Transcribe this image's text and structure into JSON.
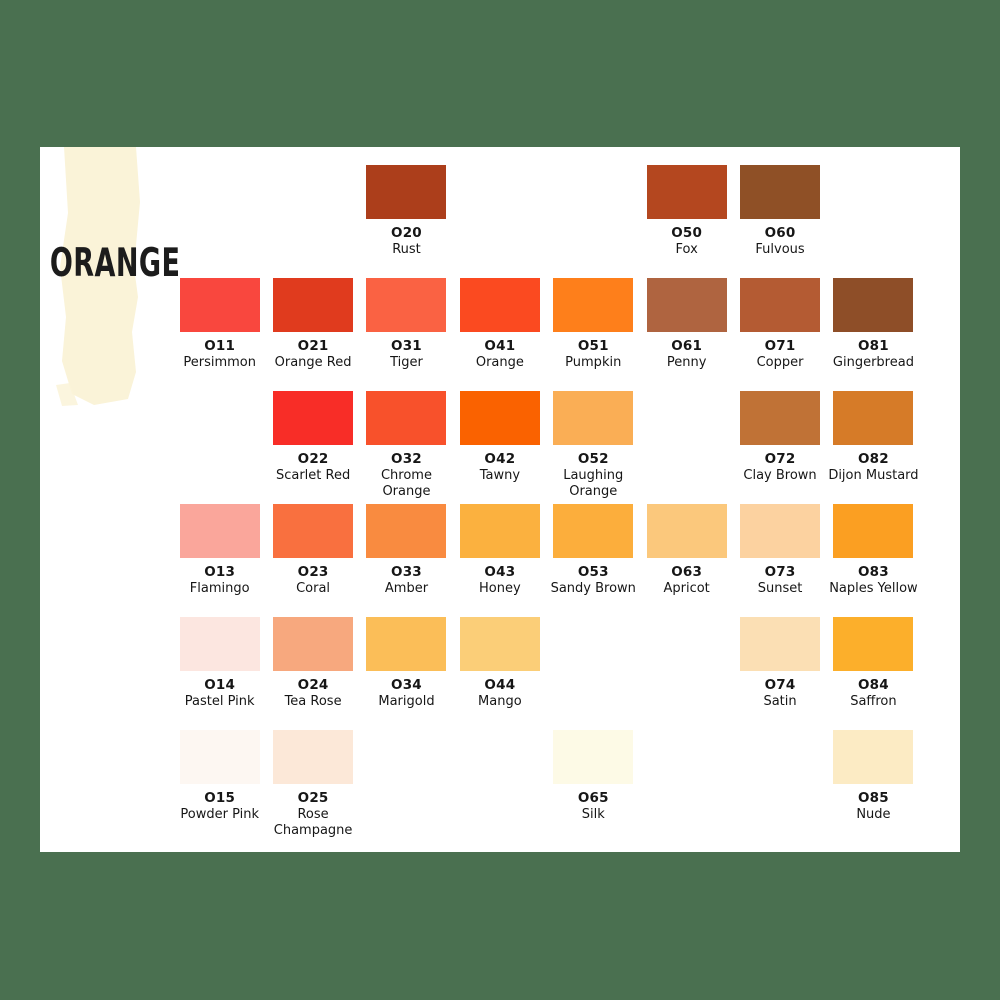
{
  "page": {
    "background_color": "#4a7050",
    "card_color": "#ffffff",
    "title": "ORANGE",
    "title_color": "#1c1c1c",
    "brush_color": "#faf3d8"
  },
  "chart_data": {
    "type": "table",
    "title": "ORANGE",
    "columns": 8,
    "rows": 6,
    "swatches": [
      [
        {
          "code": "",
          "name": "",
          "hex": "",
          "empty": true
        },
        {
          "code": "",
          "name": "",
          "hex": "",
          "empty": true
        },
        {
          "code": "O20",
          "name": "Rust",
          "hex": "#ac3e1b"
        },
        {
          "code": "",
          "name": "",
          "hex": "",
          "empty": true
        },
        {
          "code": "",
          "name": "",
          "hex": "",
          "empty": true
        },
        {
          "code": "O50",
          "name": "Fox",
          "hex": "#b4471f"
        },
        {
          "code": "O60",
          "name": "Fulvous",
          "hex": "#8f5026"
        },
        {
          "code": "",
          "name": "",
          "hex": "",
          "empty": true
        }
      ],
      [
        {
          "code": "O11",
          "name": "Persimmon",
          "hex": "#f9473e"
        },
        {
          "code": "O21",
          "name": "Orange Red",
          "hex": "#e03b1e"
        },
        {
          "code": "O31",
          "name": "Tiger",
          "hex": "#fa6243"
        },
        {
          "code": "O41",
          "name": "Orange",
          "hex": "#fb4a20"
        },
        {
          "code": "O51",
          "name": "Pumpkin",
          "hex": "#fe7f1b"
        },
        {
          "code": "O61",
          "name": "Penny",
          "hex": "#af6440"
        },
        {
          "code": "O71",
          "name": "Copper",
          "hex": "#b45b33"
        },
        {
          "code": "O81",
          "name": "Gingerbread",
          "hex": "#8e4e28"
        }
      ],
      [
        {
          "code": "",
          "name": "",
          "hex": "",
          "empty": true
        },
        {
          "code": "O22",
          "name": "Scarlet Red",
          "hex": "#f82d27"
        },
        {
          "code": "O32",
          "name": "Chrome Orange",
          "hex": "#f8512b"
        },
        {
          "code": "O42",
          "name": "Tawny",
          "hex": "#fa6200"
        },
        {
          "code": "O52",
          "name": "Laughing Orange",
          "hex": "#faae55"
        },
        {
          "code": "",
          "name": "",
          "hex": "",
          "empty": true
        },
        {
          "code": "O72",
          "name": "Clay Brown",
          "hex": "#c07236"
        },
        {
          "code": "O82",
          "name": "Dijon Mustard",
          "hex": "#d67b28"
        }
      ],
      [
        {
          "code": "O13",
          "name": "Flamingo",
          "hex": "#faa69b"
        },
        {
          "code": "O23",
          "name": "Coral",
          "hex": "#f9703f"
        },
        {
          "code": "O33",
          "name": "Amber",
          "hex": "#f98b40"
        },
        {
          "code": "O43",
          "name": "Honey",
          "hex": "#fbb13f"
        },
        {
          "code": "O53",
          "name": "Sandy Brown",
          "hex": "#fcae3c"
        },
        {
          "code": "O63",
          "name": "Apricot",
          "hex": "#fbc87c"
        },
        {
          "code": "O73",
          "name": "Sunset",
          "hex": "#fcd2a0"
        },
        {
          "code": "O83",
          "name": "Naples Yellow",
          "hex": "#fb9f22"
        }
      ],
      [
        {
          "code": "O14",
          "name": "Pastel Pink",
          "hex": "#fce6e0"
        },
        {
          "code": "O24",
          "name": "Tea Rose",
          "hex": "#f7a87e"
        },
        {
          "code": "O34",
          "name": "Marigold",
          "hex": "#fbbe58"
        },
        {
          "code": "O44",
          "name": "Mango",
          "hex": "#fbce78"
        },
        {
          "code": "",
          "name": "",
          "hex": "",
          "empty": true
        },
        {
          "code": "",
          "name": "",
          "hex": "",
          "empty": true
        },
        {
          "code": "O74",
          "name": "Satin",
          "hex": "#fbdfb4"
        },
        {
          "code": "O84",
          "name": "Saffron",
          "hex": "#fcaf2b"
        }
      ],
      [
        {
          "code": "O15",
          "name": "Powder Pink",
          "hex": "#fdf7f2"
        },
        {
          "code": "O25",
          "name": "Rose Champagne",
          "hex": "#fce8d8"
        },
        {
          "code": "",
          "name": "",
          "hex": "",
          "empty": true
        },
        {
          "code": "",
          "name": "",
          "hex": "",
          "empty": true
        },
        {
          "code": "O65",
          "name": "Silk",
          "hex": "#fdfae6"
        },
        {
          "code": "",
          "name": "",
          "hex": "",
          "empty": true
        },
        {
          "code": "",
          "name": "",
          "hex": "",
          "empty": true
        },
        {
          "code": "O85",
          "name": "Nude",
          "hex": "#fcebc4"
        }
      ]
    ]
  }
}
